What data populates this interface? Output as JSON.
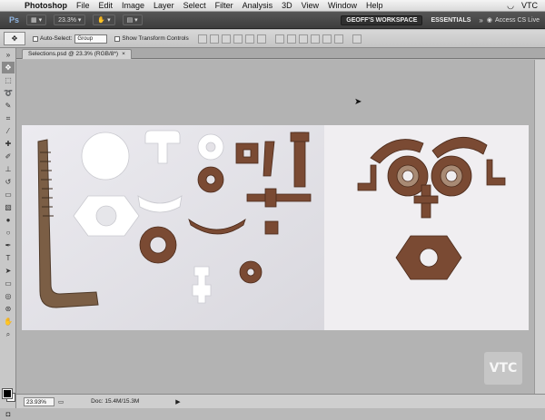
{
  "menubar": {
    "app": "Photoshop",
    "items": [
      "File",
      "Edit",
      "Image",
      "Layer",
      "Select",
      "Filter",
      "Analysis",
      "3D",
      "View",
      "Window",
      "Help"
    ],
    "vendor": "VTC"
  },
  "appbar": {
    "logo": "Ps",
    "zoom": "23.3%",
    "workspace_active": "GEOFF'S WORKSPACE",
    "workspace_essentials": "ESSENTIALS",
    "cs_live": "Access CS Live"
  },
  "options": {
    "auto_select_label": "Auto-Select:",
    "auto_select_value": "Group",
    "transform_label": "Show Transform Controls"
  },
  "document": {
    "tab_title": "Selections.psd @ 23.3% (RGB/8*)",
    "tab_close": "×"
  },
  "status": {
    "zoom": "23.93%",
    "doc_size": "Doc: 15.4M/15.3M",
    "arrow": "▶"
  },
  "watermark": "VTC",
  "colors": {
    "canvas": "#b3b3b3",
    "photo_left": "#e4e2e7",
    "photo_right": "#f0eef1",
    "rust": "#7a4a33",
    "white_piece": "#ffffff"
  }
}
